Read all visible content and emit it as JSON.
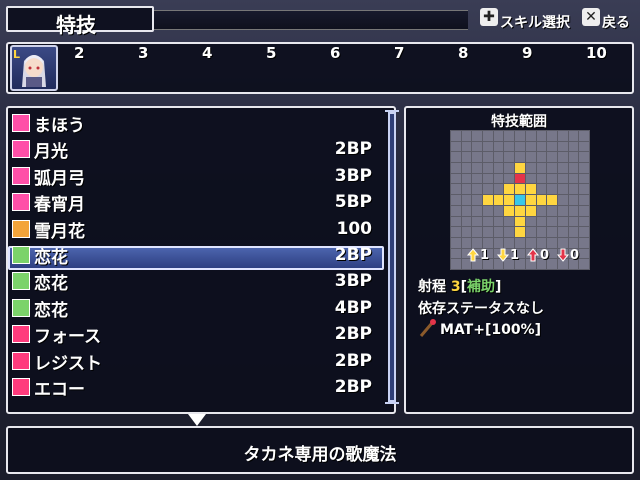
{
  "screen": {
    "title": "特技"
  },
  "hints": {
    "skill_select": "スキル選択",
    "back": "戻る"
  },
  "party": {
    "slot_badge": "L",
    "slots": [
      "2",
      "3",
      "4",
      "5",
      "6",
      "7",
      "8",
      "9",
      "10"
    ]
  },
  "skills": [
    {
      "name": "まほう",
      "cost": "",
      "icon": "magic-category-icon",
      "color": "#ff4fa8"
    },
    {
      "name": "月光",
      "cost": "2BP",
      "icon": "pink-song-icon",
      "color": "#ff4fa8"
    },
    {
      "name": "弧月弓",
      "cost": "3BP",
      "icon": "pink-song-icon",
      "color": "#ff4fa8"
    },
    {
      "name": "春宵月",
      "cost": "5BP",
      "icon": "pink-song-icon",
      "color": "#ff4fa8"
    },
    {
      "name": "雪月花",
      "cost": "100",
      "icon": "orange-pattern-icon",
      "color": "#f3a43a"
    },
    {
      "name": "恋花",
      "cost": "2BP",
      "icon": "green-note-icon",
      "color": "#7bd36a"
    },
    {
      "name": "恋花",
      "cost": "3BP",
      "icon": "green-sparkle-icon",
      "color": "#7bd36a"
    },
    {
      "name": "恋花",
      "cost": "4BP",
      "icon": "green-sparkle-icon",
      "color": "#7bd36a"
    },
    {
      "name": "フォース",
      "cost": "2BP",
      "icon": "level-up-icon",
      "color": "#ff3b7d"
    },
    {
      "name": "レジスト",
      "cost": "2BP",
      "icon": "level-up-icon",
      "color": "#ff3b7d"
    },
    {
      "name": "エコー",
      "cost": "2BP",
      "icon": "level-up-icon",
      "color": "#ff3b7d"
    }
  ],
  "selected_index": 5,
  "range": {
    "title": "特技範囲",
    "stats": [
      "1",
      "1",
      "0",
      "0"
    ],
    "range_label": "射程",
    "range_value": "3",
    "range_tag_open": "[",
    "range_tag": "補助",
    "range_tag_close": "]",
    "dependency": "依存ステータスなし",
    "effect": "MAT+[100%]"
  },
  "description": "タカネ専用の歌魔法",
  "colors": {
    "accent": "#ffd640",
    "tag": "#7bd36a",
    "selected": "#3a52a0"
  }
}
